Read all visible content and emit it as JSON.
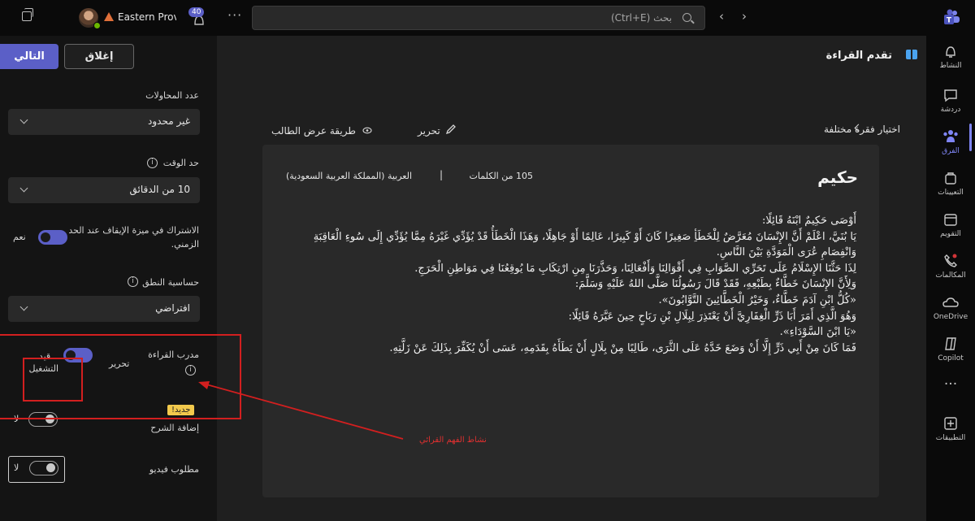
{
  "topbar": {
    "org_name": "Eastern Provi",
    "notification_count": "40",
    "search_placeholder": "بحث (Ctrl+E)"
  },
  "left_panel": {
    "next_label": "التالي",
    "close_label": "إغلاق",
    "attempts_label": "عدد المحاولات",
    "attempts_value": "غير محدود",
    "time_limit_label": "حد الوقت",
    "time_limit_value": "10 من الدقائق",
    "stop_feature_label": "الاشتراك في ميزة الإيقاف عند الحد الزمني.",
    "stop_feature_state": "نعم",
    "pronunciation_label": "حساسية النطق",
    "pronunciation_value": "افتراضي",
    "coach_label": "مدرب القراءة",
    "coach_edit": "تحرير",
    "coach_state": "قيد التشغيل",
    "new_badge": "جديد!",
    "explanation_label": "إضافة الشرح",
    "explanation_state": "لا",
    "video_label": "مطلوب فيديو",
    "video_state": "لا"
  },
  "annotation": {
    "label": "نشاط الفهم القرائي",
    "color": "#d21f1f"
  },
  "main": {
    "title": "تقدم القراءة",
    "choose_passage": "اختيار فقرة مختلفة",
    "edit": "تحرير",
    "student_view": "طريقة عرض الطالب",
    "passage_title": "حكيم",
    "word_count": "105 من الكلمات",
    "separator": "|",
    "language": "العربية (المملكة العربية السعودية)",
    "passage_lines": [
      "أَوْصَى حَكِيمٌ ابْنَهُ قَائِلًا:",
      "يَا بُنَيَّ، اعْلَمْ أَنَّ الإِنْسَانَ مُعَرَّضٌ لِلْخَطَأِ صَغِيرًا كَانَ أَوْ كَبِيرًا، عَالِمًا أَوْ جَاهِلًا، وَهَذَا الْخَطَأُ قَدْ يُؤَدِّي غَيْرَهُ مِمَّا يُؤَدِّي إِلَى سُوءِ",
      "الْعَاقِبَةِ وَانْفِصَامِ عُرَى الْمَوَدَّةِ بَيْنَ النَّاسِ.",
      "لِذَا حَثَّنَا الإِسْلَامُ عَلَى تَحَرِّي الصَّوَابِ فِي أَقْوَالِنَا وَأَفْعَالِنَا، وَحَذَّرَنَا مِنِ ارْتِكَابِ مَا يُوقِعُنَا فِي مَوَاطِنِ الْحَرَجِ.",
      "وَلِأَنَّ الإِنْسَانَ خَطَّاءٌ بِطَبْعِهِ، فَقَدْ قَالَ رَسُولُنَا صَلَّى اللهُ عَلَيْهِ وَسَلَّمَ:",
      "«كُلُّ ابْنِ آدَمَ خَطَّاءٌ، وَخَيْرُ الْخَطَّائِينَ التَّوَّابُونَ».",
      "وَهُوَ الَّذِي أَمَرَ أَبَا ذَرٍّ الْغِفَارِيَّ أَنْ يَعْتَذِرَ لِبِلَالِ بْنِ رَبَاحٍ حِينَ عَيَّرَهُ قَائِلًا:",
      "«يَا ابْنَ السَّوْدَاءِ».",
      "فَمَا كَانَ مِنْ أَبِي ذَرٍّ إِلَّا أَنْ وَضَعَ خَدَّهُ عَلَى الثَّرَى، طَالِبًا مِنْ بِلَالٍ أَنْ يَطَأَهُ بِقَدَمِهِ، عَسَى أَنْ يُكَفِّرَ بِذَلِكَ عَنْ زَلَّتِهِ."
    ]
  },
  "app_rail": [
    {
      "label": "النشاط",
      "icon": "bell-icon"
    },
    {
      "label": "دردشة",
      "icon": "chat-icon"
    },
    {
      "label": "الفرق",
      "icon": "teams-icon"
    },
    {
      "label": "التعيينات",
      "icon": "assignments-icon"
    },
    {
      "label": "التقويم",
      "icon": "calendar-icon"
    },
    {
      "label": "المكالمات",
      "icon": "phone-icon"
    },
    {
      "label": "OneDrive",
      "icon": "onedrive-icon"
    },
    {
      "label": "Copilot",
      "icon": "copilot-icon"
    },
    {
      "label": "",
      "icon": "more-icon"
    },
    {
      "label": "التطبيقات",
      "icon": "apps-icon"
    }
  ],
  "colors": {
    "accent": "#5b5fc7",
    "rail_active": "#7f85f5",
    "badge_yellow": "#f2c94c",
    "warning_orange": "#e0703a"
  }
}
